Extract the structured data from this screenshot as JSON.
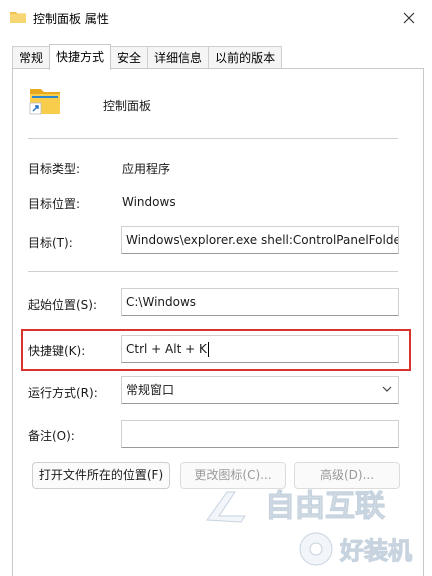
{
  "window": {
    "title": "控制面板 属性",
    "close_icon": "close-icon"
  },
  "tabs": [
    {
      "label": "常规",
      "active": false
    },
    {
      "label": "快捷方式",
      "active": true
    },
    {
      "label": "安全",
      "active": false
    },
    {
      "label": "详细信息",
      "active": false
    },
    {
      "label": "以前的版本",
      "active": false
    }
  ],
  "header": {
    "name": "控制面板",
    "icon": "folder-shortcut-icon"
  },
  "fields": {
    "target_type": {
      "label": "目标类型:",
      "value": "应用程序"
    },
    "target_location": {
      "label": "目标位置:",
      "value": "Windows"
    },
    "target": {
      "label": "目标(T):",
      "value": "Windows\\explorer.exe shell:ControlPanelFolder"
    },
    "start_in": {
      "label": "起始位置(S):",
      "value": "C:\\Windows"
    },
    "shortcut_key": {
      "label": "快捷键(K):",
      "value": "Ctrl + Alt + K"
    },
    "run": {
      "label": "运行方式(R):",
      "value": "常规窗口"
    },
    "comment": {
      "label": "备注(O):",
      "value": ""
    }
  },
  "buttons": {
    "open_location": "打开文件所在的位置(F)",
    "change_icon": "更改图标(C)...",
    "advanced": "高级(D)..."
  },
  "highlight_color": "#d9322b",
  "watermarks": [
    "自由互联",
    "好装机"
  ]
}
